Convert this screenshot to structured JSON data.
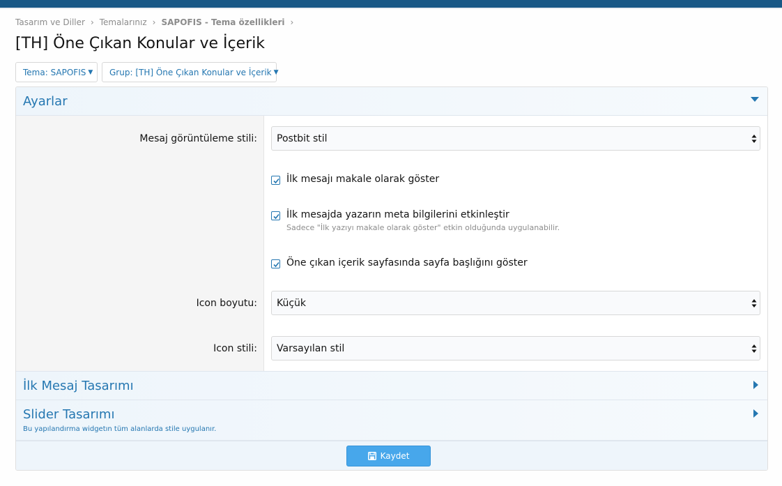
{
  "breadcrumb": {
    "items": [
      "Tasarım ve Diller",
      "Temalarınız",
      "SAPOFIS - Tema özellikleri"
    ]
  },
  "page": {
    "title": "[TH] Öne Çıkan Konular ve İçerik"
  },
  "filters": {
    "theme": "Tema: SAPOFIS",
    "group": "Grup: [TH] Öne Çıkan Konular ve İçerik"
  },
  "sections": {
    "settings": {
      "title": "Ayarlar",
      "expanded": true
    },
    "first_post": {
      "title": "İlk Mesaj Tasarımı",
      "expanded": false
    },
    "slider": {
      "title": "Slider Tasarımı",
      "description": "Bu yapılandırma widgetın tüm alanlarda stile uygulanır.",
      "expanded": false
    }
  },
  "form": {
    "message_style": {
      "label": "Mesaj görüntüleme stili:",
      "value": "Postbit stil"
    },
    "checks": [
      {
        "label": "İlk mesajı makale olarak göster",
        "checked": true,
        "hint": ""
      },
      {
        "label": "İlk mesajda yazarın meta bilgilerini etkinleştir",
        "checked": true,
        "hint": "Sadece \"İlk yazıyı makale olarak göster\" etkin olduğunda uygulanabilir."
      },
      {
        "label": "Öne çıkan içerik sayfasında sayfa başlığını göster",
        "checked": true,
        "hint": ""
      }
    ],
    "icon_size": {
      "label": "Icon boyutu:",
      "value": "Küçük"
    },
    "icon_style": {
      "label": "Icon stili:",
      "value": "Varsayılan stil"
    }
  },
  "actions": {
    "save_label": "Kaydet"
  },
  "colors": {
    "accent": "#2577b1",
    "topbar": "#185886",
    "button": "#47a7eb"
  }
}
